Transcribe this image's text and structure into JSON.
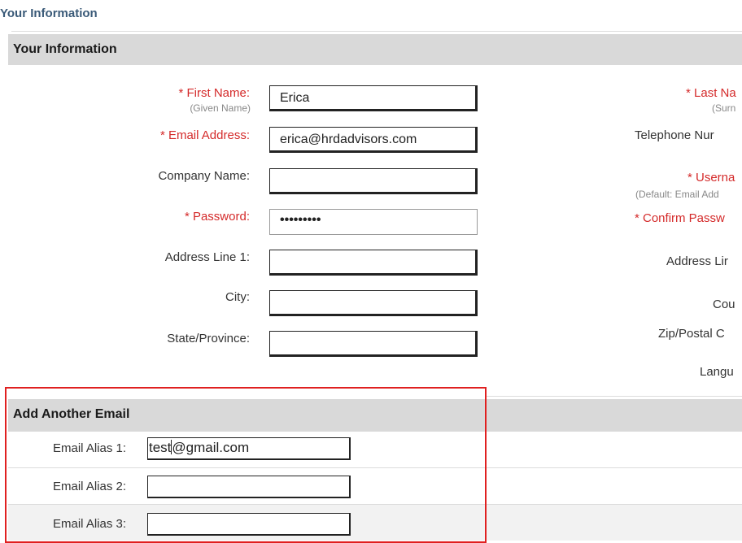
{
  "page": {
    "title": "Your Information"
  },
  "section": {
    "header": "Your Information"
  },
  "left_fields": {
    "first_name": {
      "label": "* First Name:",
      "sub": "(Given Name)",
      "value": "Erica"
    },
    "email": {
      "label": "* Email Address:",
      "value": "erica@hrdadvisors.com"
    },
    "company": {
      "label": "Company Name:",
      "value": ""
    },
    "password": {
      "label": "* Password:",
      "value": "•••••••••"
    },
    "address1": {
      "label": "Address Line 1:",
      "value": ""
    },
    "city": {
      "label": "City:",
      "value": ""
    },
    "state": {
      "label": "State/Province:",
      "value": ""
    }
  },
  "right_fields": {
    "last_name": {
      "label": "* Last Na",
      "sub": "(Surn"
    },
    "telephone": {
      "label": "Telephone Nur"
    },
    "username": {
      "label": "* Userna",
      "sub": "(Default: Email Add"
    },
    "confirm_password": {
      "label": "* Confirm Passw"
    },
    "address2": {
      "label": "Address Lir"
    },
    "country": {
      "label": "Cou"
    },
    "zip": {
      "label": "Zip/Postal C"
    },
    "language": {
      "label": "Langu"
    }
  },
  "alias_section": {
    "header": "Add Another Email",
    "aliases": [
      {
        "label": "Email Alias 1:",
        "value_before_caret": "test",
        "value_after_caret": "@gmail.com"
      },
      {
        "label": "Email Alias 2:",
        "value": ""
      },
      {
        "label": "Email Alias 3:",
        "value": ""
      }
    ]
  },
  "colors": {
    "required": "#d42a2a",
    "header_bg": "#d9d9d9",
    "title": "#3a5a78",
    "highlight": "#e02020"
  }
}
